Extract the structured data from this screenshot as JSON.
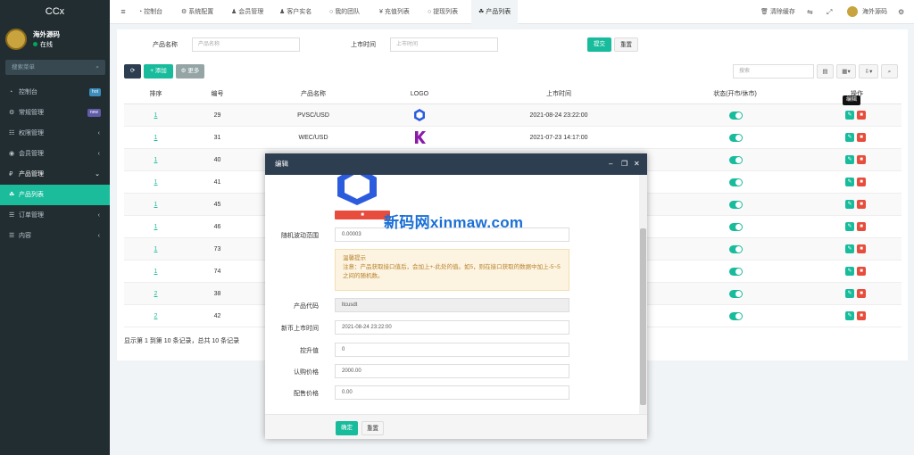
{
  "brand": "CCx",
  "user": {
    "name": "海外源码",
    "status": "在线"
  },
  "sidebar": {
    "search_placeholder": "搜索菜单",
    "items": [
      {
        "label": "控制台",
        "icon": "dashboard-icon",
        "badge": "hot",
        "badge_color": "#3c8dbc"
      },
      {
        "label": "常规管理",
        "icon": "cogs-icon",
        "badge": "new",
        "badge_color": "#605ca8"
      },
      {
        "label": "权限管理",
        "icon": "group-icon"
      },
      {
        "label": "会员管理",
        "icon": "user-circle-icon"
      },
      {
        "label": "产品管理",
        "icon": "product-icon"
      },
      {
        "label": "产品列表",
        "icon": "product-list-icon"
      },
      {
        "label": "订单管理",
        "icon": "order-icon"
      },
      {
        "label": "内容",
        "icon": "content-icon"
      }
    ]
  },
  "topbar": {
    "tabs": [
      {
        "label": "控制台",
        "icon": "dashboard-icon"
      },
      {
        "label": "系统配置",
        "icon": "gear-icon"
      },
      {
        "label": "会员管理",
        "icon": "user-icon"
      },
      {
        "label": "客户实名",
        "icon": "user-icon"
      },
      {
        "label": "我的团队",
        "icon": "circle-icon"
      },
      {
        "label": "充值列表",
        "icon": "yen-icon"
      },
      {
        "label": "提现列表",
        "icon": "circle-icon"
      },
      {
        "label": "产品列表",
        "icon": "product-list-icon"
      }
    ],
    "clear_cache": "清除缓存",
    "username": "海外源码"
  },
  "filters": {
    "name_label": "产品名称",
    "name_placeholder": "产品名称",
    "time_label": "上市时间",
    "time_placeholder": "上市时间",
    "submit": "提交",
    "reset": "重置"
  },
  "toolbar": {
    "add": "添加",
    "more": "更多",
    "search_placeholder": "搜索"
  },
  "table": {
    "headers": [
      "排序",
      "编号",
      "产品名称",
      "LOGO",
      "上市时间",
      "状态(开市/休市)",
      "操作"
    ],
    "rows": [
      {
        "sort": "1",
        "id": "29",
        "name": "PVSC/USD",
        "time": "2021-08-24 23:22:00"
      },
      {
        "sort": "1",
        "id": "31",
        "name": "WEC/USD",
        "time": "2021-07-23 14:17:00"
      },
      {
        "sort": "1",
        "id": "40",
        "name": "",
        "time": ""
      },
      {
        "sort": "1",
        "id": "41",
        "name": "",
        "time": ""
      },
      {
        "sort": "1",
        "id": "45",
        "name": "",
        "time": ""
      },
      {
        "sort": "1",
        "id": "46",
        "name": "",
        "time": ""
      },
      {
        "sort": "1",
        "id": "73",
        "name": "",
        "time": ""
      },
      {
        "sort": "1",
        "id": "74",
        "name": "",
        "time": ""
      },
      {
        "sort": "2",
        "id": "38",
        "name": "",
        "time": ""
      },
      {
        "sort": "2",
        "id": "42",
        "name": "",
        "time": ""
      }
    ],
    "tooltip": "编辑"
  },
  "pager": "显示第 1 到第 10 条记录，总共 10 条记录",
  "modal": {
    "title": "编辑",
    "fields": [
      {
        "label": "随机波动范围",
        "value": "0.00003"
      },
      {
        "label": "产品代码",
        "value": "ltcusdt"
      },
      {
        "label": "新币上市时间",
        "value": "2021-08-24 23:22:00"
      },
      {
        "label": "控升值",
        "value": "0"
      },
      {
        "label": "认购价格",
        "value": "2000.00"
      },
      {
        "label": "配售价格",
        "value": "0.00"
      }
    ],
    "warning_title": "温馨提示",
    "warning_text": "注意：产品获取接口值后，会加上+-此处的值。如5，则在接口获取的数据中加上-5~5之间的随机数。",
    "confirm": "确定",
    "reset": "重置"
  },
  "watermark": "新码网xinmaw.com"
}
